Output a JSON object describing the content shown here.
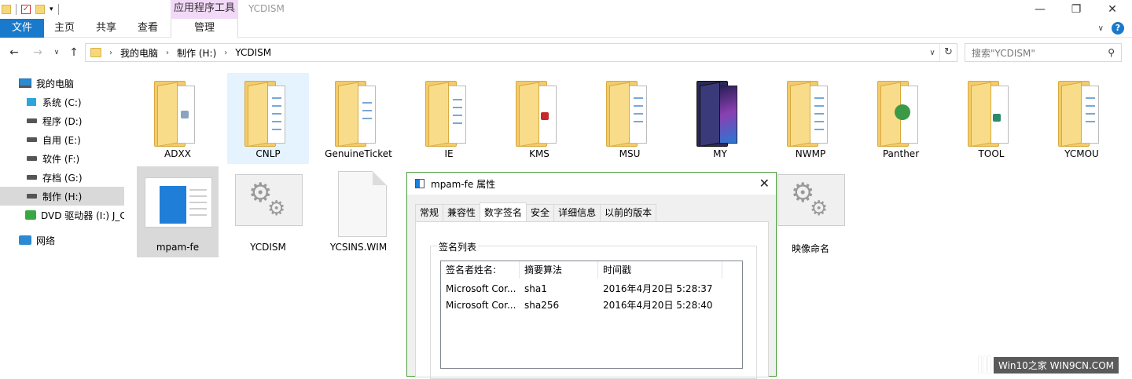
{
  "titlebar": {
    "context_tab": "应用程序工具",
    "title": "YCDISM"
  },
  "ribbon": {
    "file": "文件",
    "tabs": [
      "主页",
      "共享",
      "查看"
    ],
    "manage": "管理"
  },
  "address": {
    "crumbs": [
      "我的电脑",
      "制作 (H:)",
      "YCDISM"
    ],
    "search_placeholder": "搜索\"YCDISM\""
  },
  "sidebar": {
    "items": [
      {
        "label": "我的电脑",
        "icon": "computer-icon"
      },
      {
        "label": "系统 (C:)",
        "icon": "windows-drive-icon"
      },
      {
        "label": "程序 (D:)",
        "icon": "drive-icon"
      },
      {
        "label": "自用 (E:)",
        "icon": "drive-icon"
      },
      {
        "label": "软件 (F:)",
        "icon": "drive-icon"
      },
      {
        "label": "存档 (G:)",
        "icon": "drive-icon"
      },
      {
        "label": "制作 (H:)",
        "icon": "drive-icon"
      },
      {
        "label": "DVD 驱动器 (I:) J_C",
        "icon": "dvd-drive-icon"
      },
      {
        "label": "网络",
        "icon": "network-icon"
      }
    ]
  },
  "files": {
    "row1": [
      "ADXX",
      "CNLP",
      "GenuineTicket",
      "IE",
      "KMS",
      "MSU",
      "MY",
      "NWMP",
      "Panther",
      "TOOL",
      "YCMOU"
    ],
    "row2": [
      "mpam-fe",
      "YCDISM",
      "YCSINS.WIM",
      "映像命名"
    ]
  },
  "dialog": {
    "title": "mpam-fe 属性",
    "tabs": [
      "常规",
      "兼容性",
      "数字签名",
      "安全",
      "详细信息",
      "以前的版本"
    ],
    "group_label": "签名列表",
    "columns": [
      "签名者姓名:",
      "摘要算法",
      "时间戳"
    ],
    "rows": [
      {
        "name": "Microsoft Cor...",
        "algo": "sha1",
        "time": "2016年4月20日 5:28:37"
      },
      {
        "name": "Microsoft Cor...",
        "algo": "sha256",
        "time": "2016年4月20日 5:28:40"
      }
    ]
  },
  "watermark": {
    "text": "Win10之家 WIN9CN.COM"
  },
  "colors": {
    "accent": "#1979ca",
    "context": "#f2d9f7",
    "dialog_border": "#4a9d3c"
  }
}
